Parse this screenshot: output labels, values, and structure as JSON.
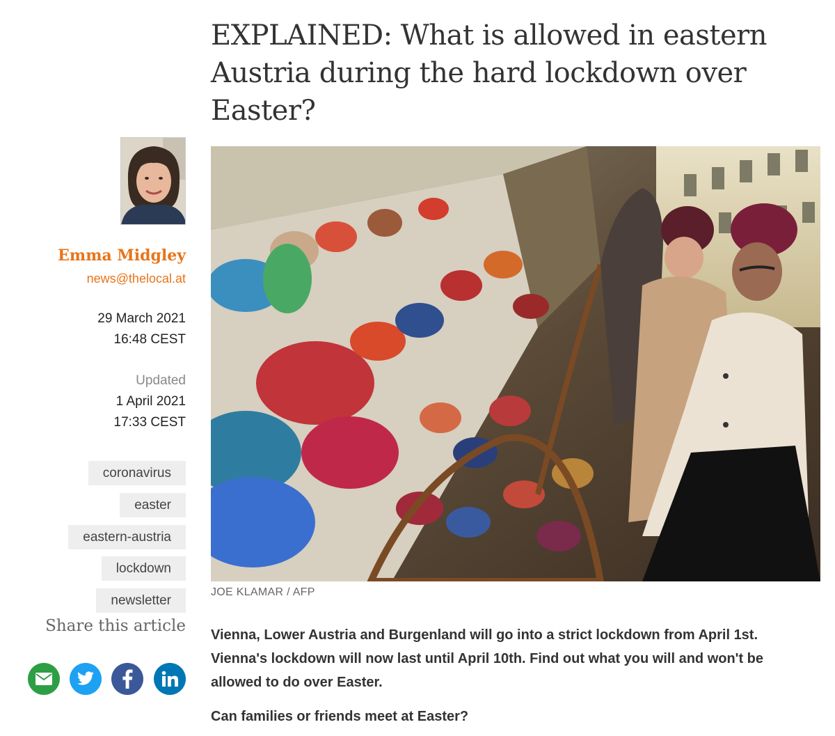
{
  "article": {
    "title": "EXPLAINED: What is allowed in eastern Austria during the hard lockdown over Easter?",
    "photo_credit": "JOE KLAMAR / AFP",
    "lede": "Vienna, Lower Austria and Burgenland will go into a strict lockdown from April 1st. Vienna's lockdown will now last until April 10th. Find out what you will and won't be allowed to do over Easter.",
    "first_subheading": "Can families or friends meet at Easter?"
  },
  "author": {
    "name": "Emma Midgley",
    "email": "news@thelocal.at"
  },
  "published": {
    "date": "29 March 2021",
    "time": "16:48 CEST"
  },
  "updated": {
    "label": "Updated",
    "date": "1 April 2021",
    "time": "17:33 CEST"
  },
  "tags": [
    "coronavirus",
    "easter",
    "eastern-austria",
    "lockdown",
    "newsletter"
  ],
  "share": {
    "title": "Share this article",
    "buttons": [
      {
        "name": "email",
        "icon": "envelope-icon",
        "color": "#2e9e45"
      },
      {
        "name": "twitter",
        "icon": "twitter-bird-icon",
        "color": "#1da1f2"
      },
      {
        "name": "facebook",
        "icon": "facebook-f-icon",
        "color": "#3b5998"
      },
      {
        "name": "linkedin",
        "icon": "linkedin-in-icon",
        "color": "#0077b5"
      }
    ]
  },
  "colors": {
    "accent": "#e8741a",
    "tag_bg": "#eeeeee"
  }
}
